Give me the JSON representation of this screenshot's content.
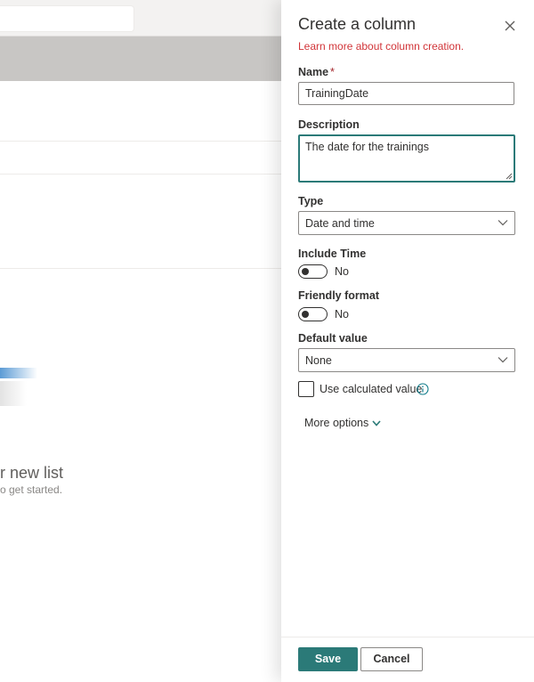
{
  "background": {
    "empty_title": "r new list",
    "empty_subtitle": "o get started."
  },
  "panel": {
    "title": "Create a column",
    "learn_more": "Learn more about column creation.",
    "name": {
      "label": "Name",
      "required_marker": "*",
      "value": "TrainingDate"
    },
    "description": {
      "label": "Description",
      "value": "The date for the trainings"
    },
    "type": {
      "label": "Type",
      "value": "Date and time"
    },
    "include_time": {
      "label": "Include Time",
      "state_text": "No",
      "on": false
    },
    "friendly_format": {
      "label": "Friendly format",
      "state_text": "No",
      "on": false
    },
    "default_value": {
      "label": "Default value",
      "value": "None"
    },
    "use_calculated": {
      "label": "Use calculated value",
      "checked": false
    },
    "more_options": "More options",
    "save": "Save",
    "cancel": "Cancel"
  },
  "colors": {
    "accent": "#2b7a78",
    "link_red": "#d13438",
    "required_red": "#a4262c",
    "info_teal": "#0f7b8a"
  },
  "icons": {
    "close": "close-icon",
    "chevron": "chevron-down-icon",
    "info": "info-icon"
  }
}
